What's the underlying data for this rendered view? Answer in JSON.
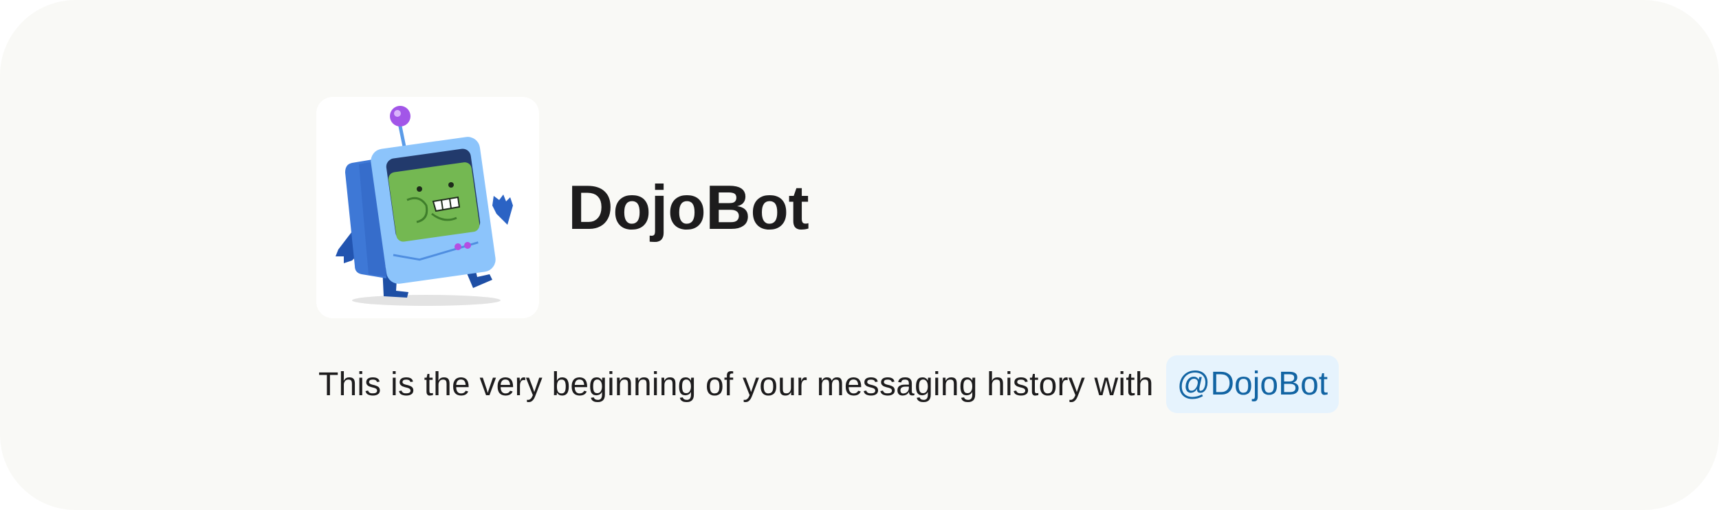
{
  "bot": {
    "name": "DojoBot",
    "avatar_icon": "robot-mascot-icon"
  },
  "intro": {
    "text": "This is the very beginning of your messaging history with",
    "mention": "@DojoBot"
  },
  "colors": {
    "background": "#f9f9f6",
    "text": "#1d1c1d",
    "mention_text": "#1264a3",
    "mention_background": "#e6f3fd"
  }
}
